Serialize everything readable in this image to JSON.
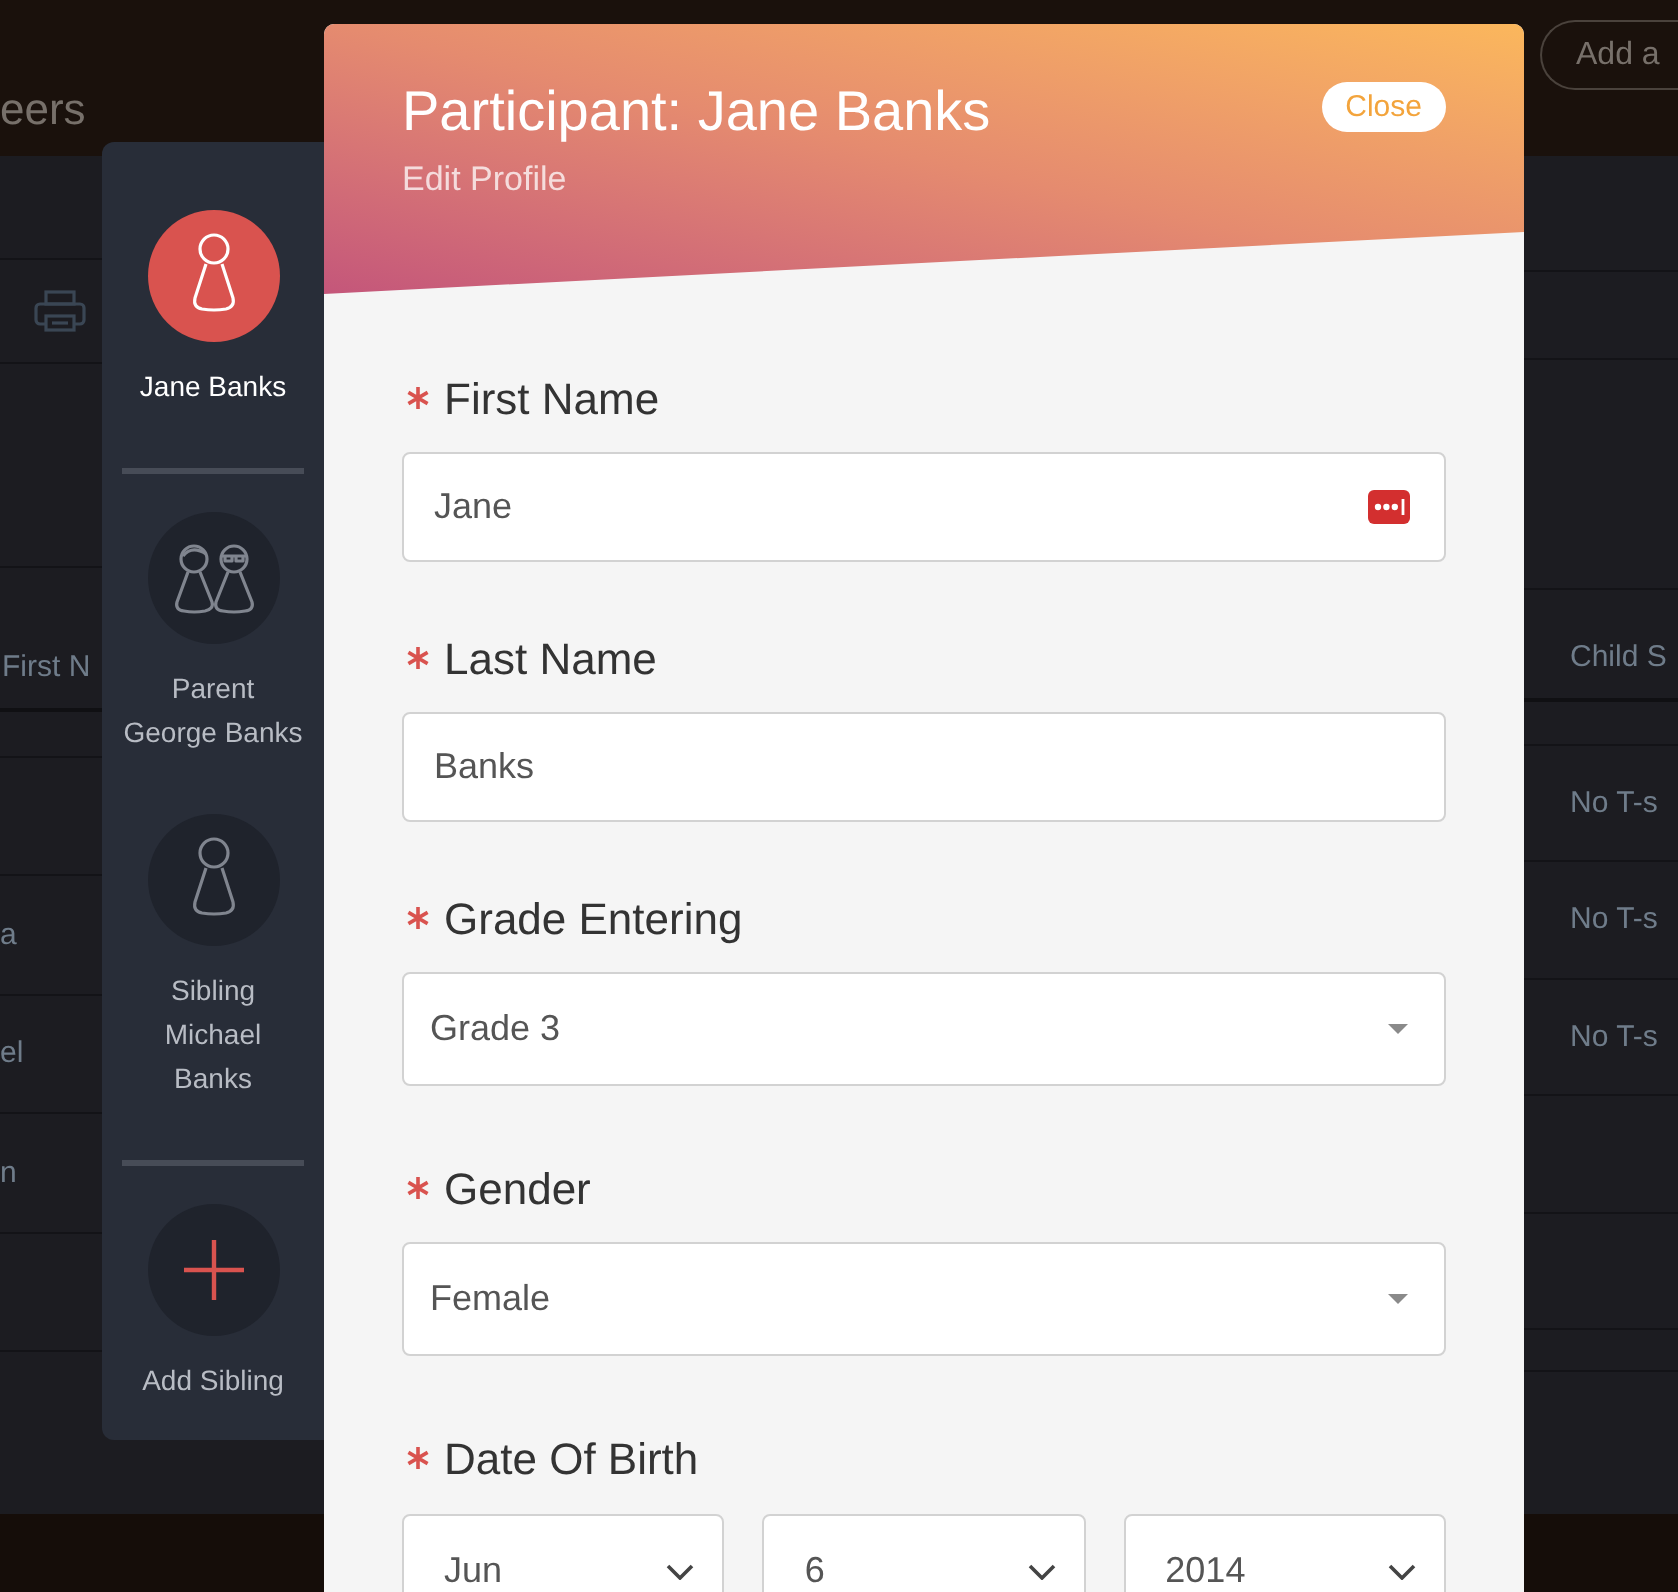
{
  "background_page": {
    "title": "eers",
    "add_button": "Add a",
    "first_column": {
      "header": "First N",
      "cells": [
        "a",
        "el",
        "n"
      ]
    },
    "last_column": {
      "header": "Child S",
      "cells": [
        "No T-s",
        "No T-s",
        "No T-s"
      ]
    }
  },
  "sidebar": {
    "groups": [
      {
        "items": [
          {
            "kind": "person",
            "selected": true,
            "lines": [
              "Jane Banks"
            ]
          }
        ]
      },
      {
        "items": [
          {
            "kind": "couple",
            "selected": false,
            "lines": [
              "Parent",
              "George Banks"
            ]
          },
          {
            "kind": "person",
            "selected": false,
            "lines": [
              "Sibling",
              "Michael",
              "Banks"
            ]
          }
        ]
      },
      {
        "items": [
          {
            "kind": "add",
            "selected": false,
            "lines": [
              "Add Sibling"
            ]
          }
        ]
      }
    ]
  },
  "modal": {
    "title": "Participant: Jane Banks",
    "subtitle": "Edit Profile",
    "close_button": "Close"
  },
  "form": {
    "fields": [
      {
        "kind": "text",
        "label": "First Name",
        "required": true,
        "value": "Jane",
        "autofill_icon": true
      },
      {
        "kind": "text",
        "label": "Last Name",
        "required": true,
        "value": "Banks"
      },
      {
        "kind": "select",
        "label": "Grade Entering",
        "required": true,
        "value": "Grade 3"
      },
      {
        "kind": "select",
        "label": "Gender",
        "required": true,
        "value": "Female"
      },
      {
        "kind": "date",
        "label": "Date Of Birth",
        "required": true,
        "parts": [
          "Jun",
          "6",
          "2014"
        ]
      }
    ]
  }
}
